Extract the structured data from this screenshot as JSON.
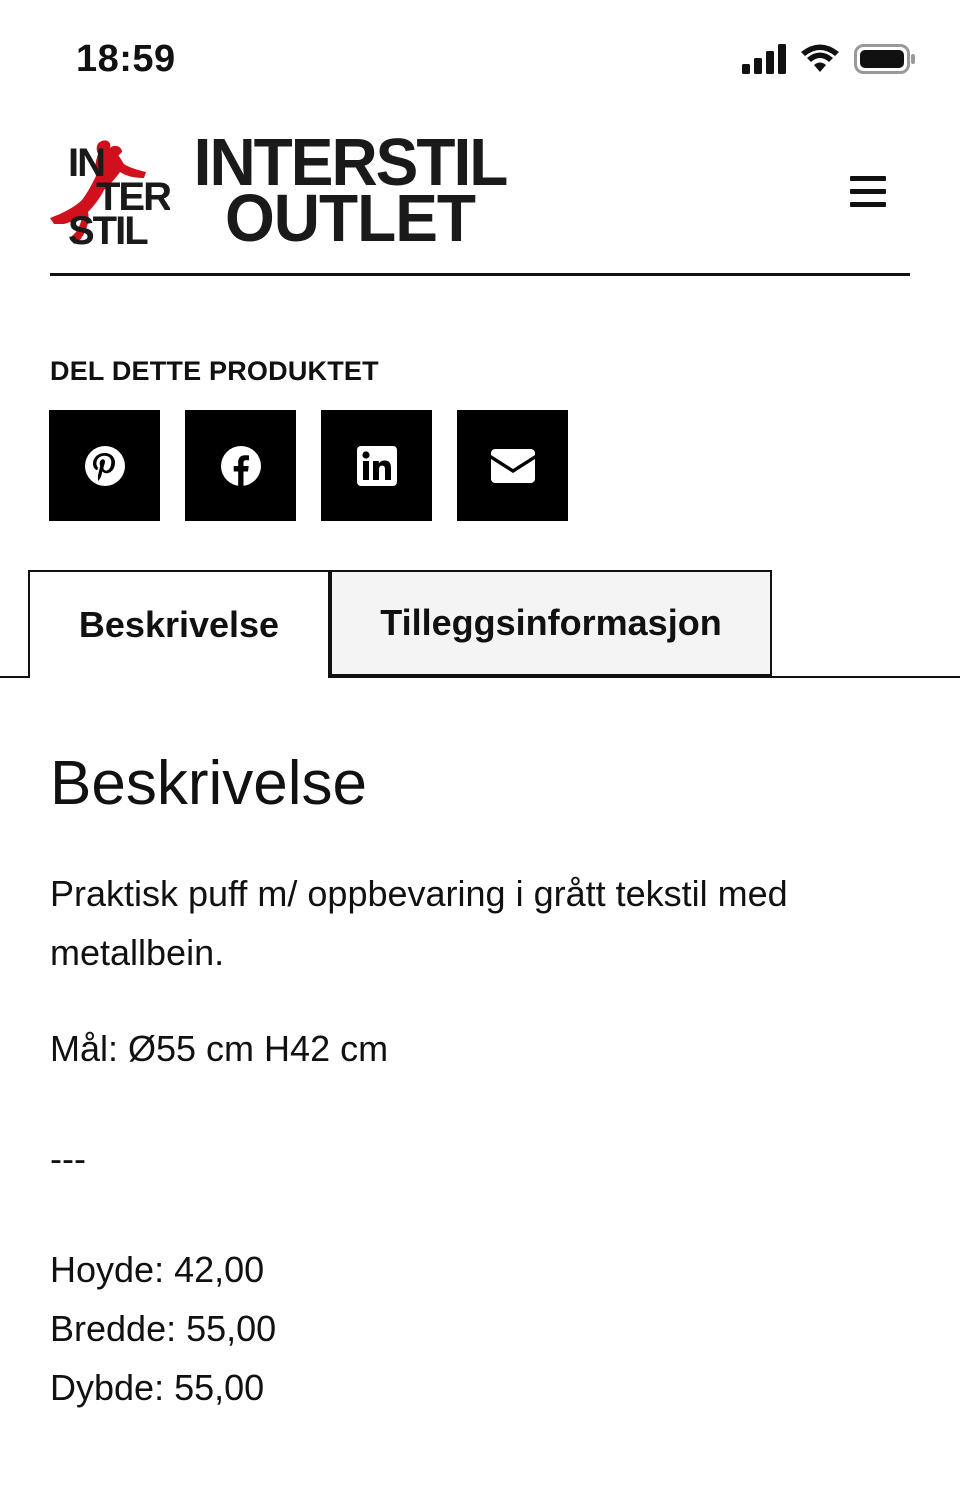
{
  "status_bar": {
    "time": "18:59"
  },
  "header": {
    "logo_mark_lines": [
      "IN",
      "TER",
      "STIL"
    ],
    "logo_title_line1": "INTERSTIL",
    "logo_title_line2": "OUTLET",
    "brand_red": "#d0101c",
    "menu_icon": "hamburger-icon"
  },
  "share": {
    "heading": "DEL DETTE PRODUKTET",
    "buttons": [
      {
        "icon": "pinterest-icon"
      },
      {
        "icon": "facebook-icon"
      },
      {
        "icon": "linkedin-icon"
      },
      {
        "icon": "email-icon"
      }
    ]
  },
  "tabs": [
    {
      "label": "Beskrivelse",
      "active": true
    },
    {
      "label": "Tilleggsinformasjon",
      "active": false
    }
  ],
  "content": {
    "title": "Beskrivelse",
    "description": "Praktisk puff m/ oppbevaring i grått tekstil med metallbein.",
    "measure": "Mål: Ø55 cm H42 cm",
    "separator": "---",
    "dimensions": [
      "Hoyde: 42,00",
      "Bredde: 55,00",
      "Dybde: 55,00"
    ]
  }
}
